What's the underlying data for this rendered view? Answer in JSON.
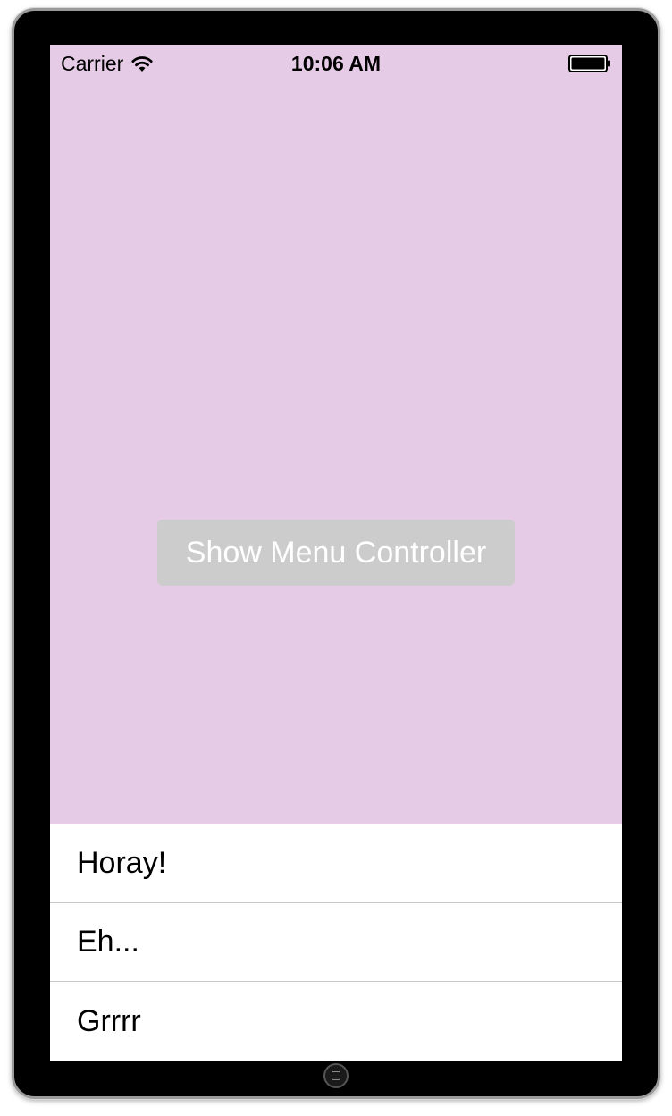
{
  "status_bar": {
    "carrier": "Carrier",
    "time": "10:06 AM",
    "wifi_icon": "wifi-icon",
    "battery_icon": "battery-icon"
  },
  "main": {
    "button_label": "Show Menu Controller",
    "background_color": "#e6cbe6",
    "button_color": "#cccccc"
  },
  "options": {
    "items": [
      {
        "label": "Horay!"
      },
      {
        "label": "Eh..."
      },
      {
        "label": "Grrrr"
      }
    ]
  },
  "device": {
    "home_button_icon": "home-button-icon"
  }
}
